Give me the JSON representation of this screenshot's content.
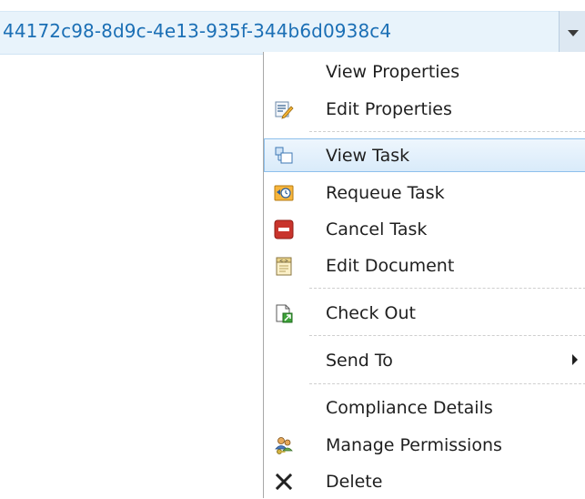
{
  "title_bar": {
    "item_id": "44172c98-8d9c-4e13-935f-344b6d0938c4"
  },
  "menu": {
    "items": [
      {
        "label": "View Properties",
        "icon": "none"
      },
      {
        "label": "Edit Properties",
        "icon": "edit-properties-icon"
      },
      {
        "label": "View Task",
        "icon": "view-task-icon",
        "selected": true
      },
      {
        "label": "Requeue Task",
        "icon": "requeue-task-icon"
      },
      {
        "label": "Cancel Task",
        "icon": "cancel-task-icon"
      },
      {
        "label": "Edit Document",
        "icon": "edit-document-icon"
      },
      {
        "label": "Check Out",
        "icon": "check-out-icon"
      },
      {
        "label": "Send To",
        "icon": "none",
        "has_submenu": true
      },
      {
        "label": "Compliance Details",
        "icon": "none"
      },
      {
        "label": "Manage Permissions",
        "icon": "manage-permissions-icon"
      },
      {
        "label": "Delete",
        "icon": "delete-icon"
      }
    ]
  },
  "colors": {
    "title_text": "#1b6fb5",
    "selected_border": "#8ec0ec",
    "menu_text": "#1f1f1f"
  }
}
